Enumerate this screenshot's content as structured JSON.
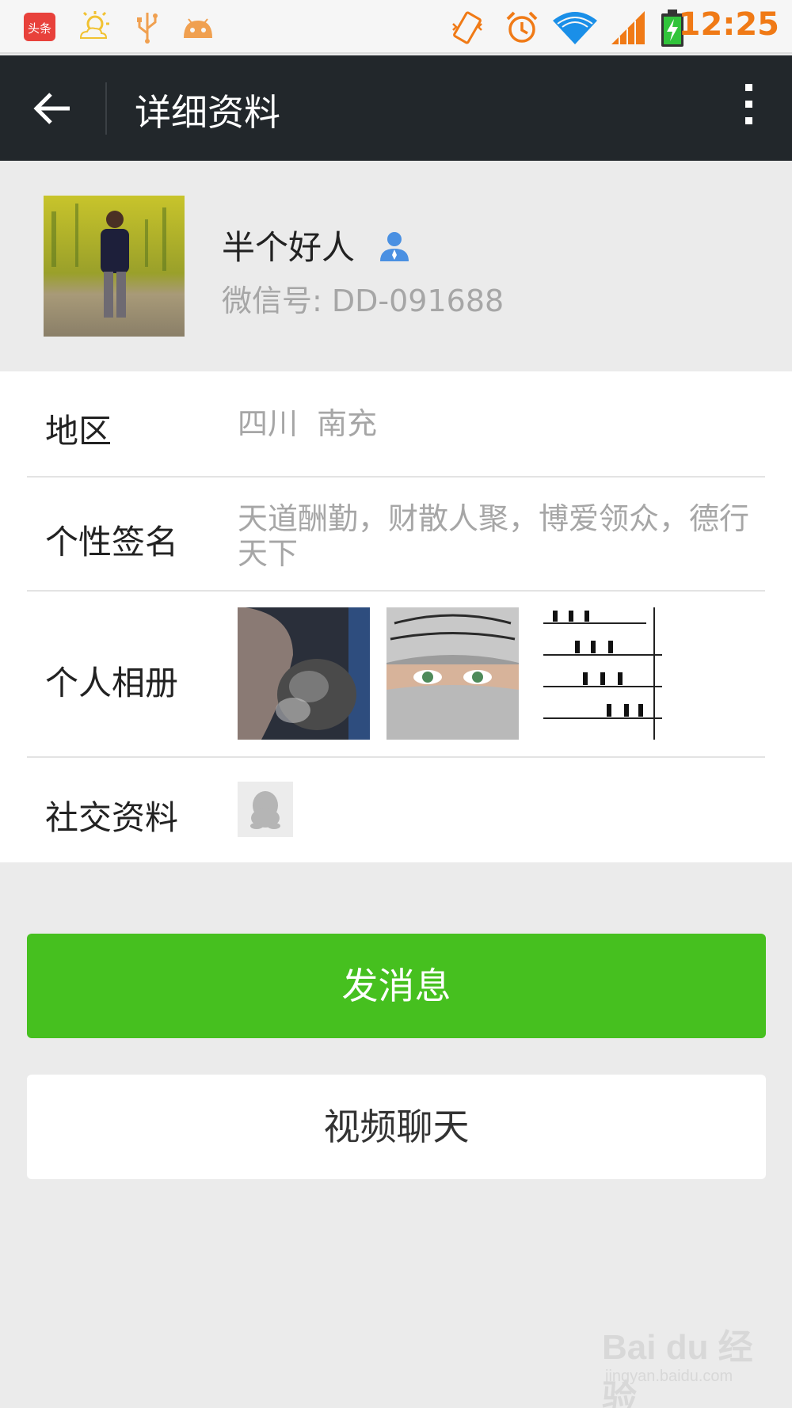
{
  "status_bar": {
    "time": "12:25",
    "app_badge": "头条",
    "icons": [
      "toutiao-icon",
      "weather-icon",
      "usb-icon",
      "android-icon",
      "vibrate-icon",
      "alarm-icon",
      "wifi-icon",
      "signal-icon",
      "battery-charging-icon"
    ]
  },
  "action_bar": {
    "title": "详细资料",
    "back_icon": "arrow-left-icon",
    "more_icon": "more-vertical-icon"
  },
  "profile": {
    "nickname": "半个好人",
    "wechat_id": "微信号: DD-091688",
    "contact_icon": "contact-person-icon"
  },
  "info_rows": {
    "region": {
      "label": "地区",
      "value": "四川  南充"
    },
    "signature": {
      "label": "个性签名",
      "value": "天道酬勤，财散人聚，博爱领众，德行天下"
    },
    "album": {
      "label": "个人相册"
    },
    "social": {
      "label": "社交资料",
      "icon": "qq-penguin-icon"
    }
  },
  "buttons": {
    "send_message": "发消息",
    "video_chat": "视频聊天"
  },
  "colors": {
    "action_bar_bg": "#22272b",
    "primary_green": "#46c01f",
    "page_bg": "#ebebeb",
    "time_orange": "#f07a16"
  },
  "watermark": {
    "main": "Bai du 经验",
    "sub": "jingyan.baidu.com"
  }
}
